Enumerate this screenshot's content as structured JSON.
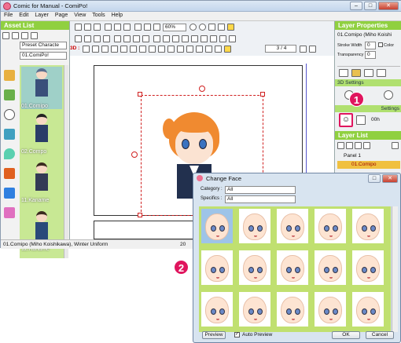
{
  "window": {
    "title": "Comic for Manual - ComiPo!",
    "min_btn": "–",
    "max_btn": "□",
    "close_btn": "✕"
  },
  "menu": [
    "File",
    "Edit",
    "Layer",
    "Page",
    "View",
    "Tools",
    "Help"
  ],
  "toolbar": {
    "zoom": "60%",
    "page_indicator": "3 / 4",
    "threed_label": "3D :"
  },
  "asset_list": {
    "title": "Asset List",
    "category_select": "Preset Characte",
    "character_select": "01.ComiPo!",
    "items": [
      {
        "label": "01.Comipo",
        "color": "#3a4f7a"
      },
      {
        "label": "02.Compo",
        "color": "#2a3c68"
      },
      {
        "label": "11.Kaname",
        "color": "#333a55"
      },
      {
        "label": "12.Kaname",
        "color": "#2a4a7a"
      }
    ]
  },
  "status": {
    "text": "01.Comipo (Miho Koishikawa), Winter Uniform",
    "zoom": "20"
  },
  "layer_properties": {
    "title": "Layer Properties",
    "layer_name": "01.Comipo (Miho Koishi",
    "stroke_width_label": "Stroke Width",
    "stroke_width_value": "0",
    "color_label": "Color",
    "transparency_label": "Transparency",
    "transparency_value": "0",
    "threed_settings": "3D Settings",
    "posing_label": "Settings",
    "facing_label": "00h"
  },
  "layer_list": {
    "title": "Layer List",
    "panel": "Panel 1",
    "layer": "01.Comipo"
  },
  "change_face": {
    "title": "Change Face",
    "category_label": "Category :",
    "category_value": "All",
    "specifics_label": "Specifics :",
    "specifics_value": "All",
    "preview_button": "Preview",
    "auto_preview": "Auto Preview",
    "ok_button": "OK",
    "cancel_button": "Cancel"
  },
  "callouts": [
    "1",
    "2"
  ],
  "colors": {
    "accent_green": "#90d040",
    "callout": "#e0155e",
    "selection": "#d02020"
  }
}
